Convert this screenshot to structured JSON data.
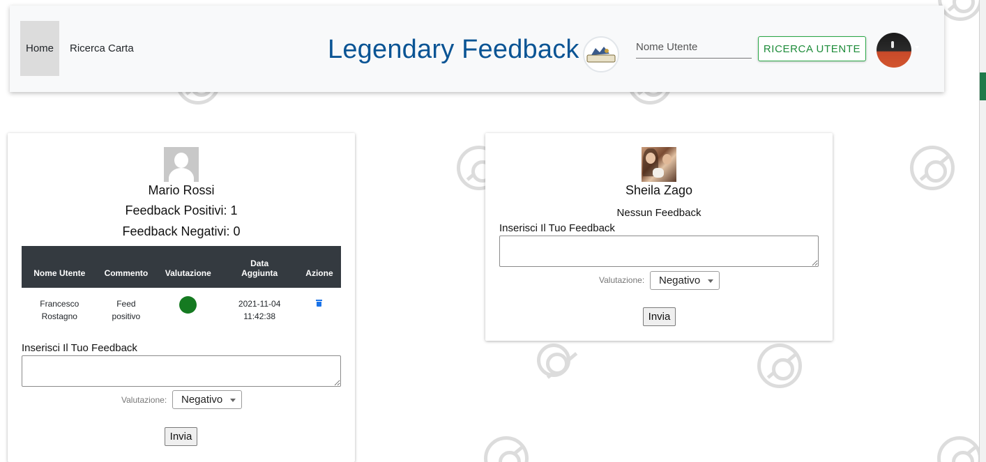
{
  "nav": {
    "home_label": "Home",
    "search_card_label": "Ricerca Carta",
    "brand_title": "Legendary Feedback",
    "user_placeholder": "Nome Utente",
    "search_user_button": "RICERCA UTENTE"
  },
  "cards": [
    {
      "name": "Mario Rossi",
      "positive_label": "Feedback Positivi: 1",
      "negative_label": "Feedback Negativi: 0",
      "table": {
        "headers": [
          "Nome Utente",
          "Commento",
          "Valutazione",
          "Data Aggiunta",
          "Azione"
        ],
        "rows": [
          {
            "user": "Francesco Rostagno",
            "comment": "Feed positivo",
            "rating": "positive",
            "date": "2021-11-04 11:42:38"
          }
        ]
      },
      "form_label": "Inserisci Il Tuo Feedback",
      "rating_label": "Valutazione:",
      "rating_value": "Negativo",
      "submit_label": "Invia"
    },
    {
      "name": "Sheila Zago",
      "no_feedback": "Nessun Feedback",
      "form_label": "Inserisci Il Tuo Feedback",
      "rating_label": "Valutazione:",
      "rating_value": "Negativo",
      "submit_label": "Invia"
    }
  ],
  "colors": {
    "brand": "#0a5494",
    "success": "#28a745",
    "positive_dot": "#157a21",
    "table_header": "#343a40"
  },
  "icons": [
    "pokeball-watermark-icon",
    "trash-icon",
    "select-arrow-icon"
  ]
}
